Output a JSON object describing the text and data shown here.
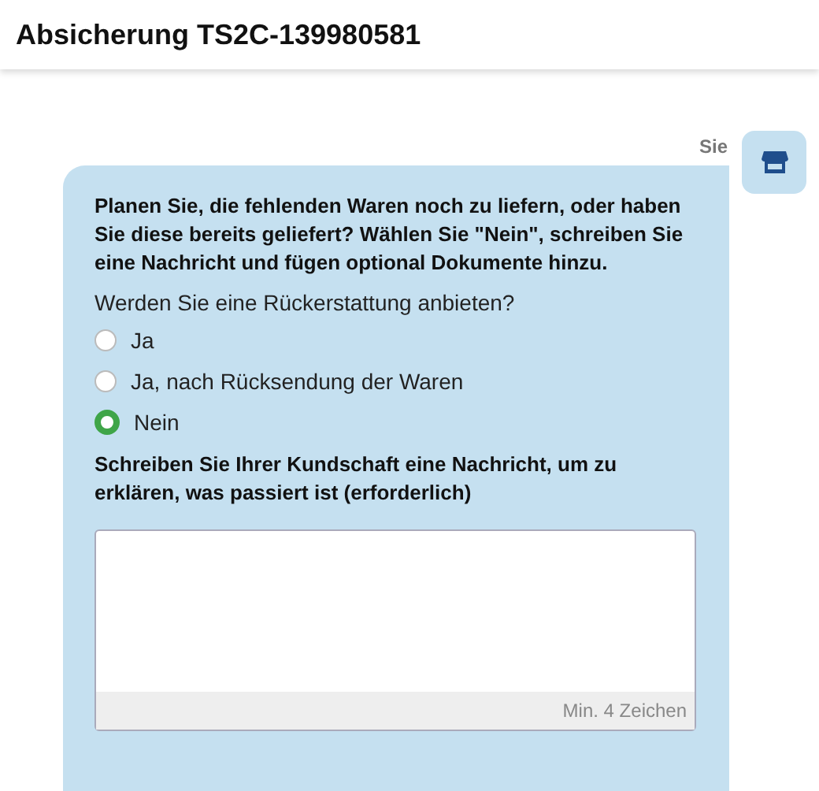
{
  "header": {
    "title": "Absicherung TS2C-139980581"
  },
  "message": {
    "sender": "Sie",
    "intro": "Planen Sie, die fehlenden Waren noch zu liefern, oder haben Sie diese bereits geliefert? Wählen Sie \"Nein\", schreiben Sie eine Nachricht und fügen optional Dokumente hinzu.",
    "question": "Werden Sie eine Rückerstattung anbieten?",
    "options": [
      {
        "label": "Ja",
        "selected": false
      },
      {
        "label": "Ja, nach Rücksendung der Waren",
        "selected": false
      },
      {
        "label": "Nein",
        "selected": true
      }
    ],
    "message_label": "Schreiben Sie Ihrer Kundschaft eine Nachricht, um zu erklären, was passiert ist (erforderlich)",
    "message_hint": "Min. 4 Zeichen"
  }
}
